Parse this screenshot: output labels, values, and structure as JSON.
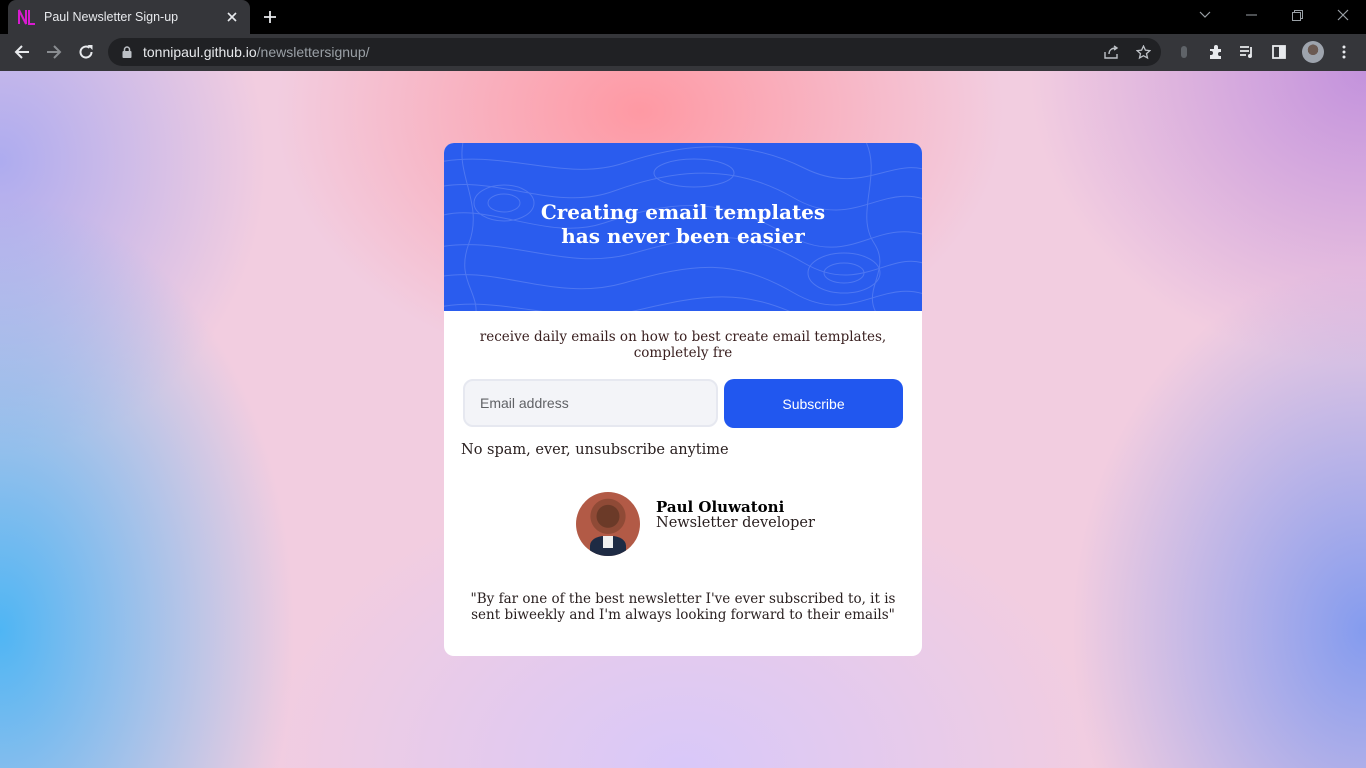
{
  "browser": {
    "tab": {
      "title": "Paul Newsletter Sign-up",
      "favicon": "NL-logo"
    },
    "address": {
      "host": "tonnipaul.github.io",
      "path": "/newslettersignup/"
    }
  },
  "page": {
    "hero": {
      "title_line1": "Creating email templates",
      "title_line2": "has never been easier"
    },
    "lead": "receive daily emails on how to best create email templates, completely fre",
    "form": {
      "email_placeholder": "Email address",
      "subscribe_label": "Subscribe"
    },
    "note": "No spam, ever, unsubscribe anytime",
    "author": {
      "name": "Paul Oluwatoni",
      "role": "Newsletter developer"
    },
    "quote": "\"By far one of the best newsletter I've ever subscribed to, it is sent biweekly and I'm always looking forward to their emails\""
  },
  "colors": {
    "accent": "#2157ef",
    "hero_bg": "#2a5cee",
    "chrome": "#35363a"
  }
}
